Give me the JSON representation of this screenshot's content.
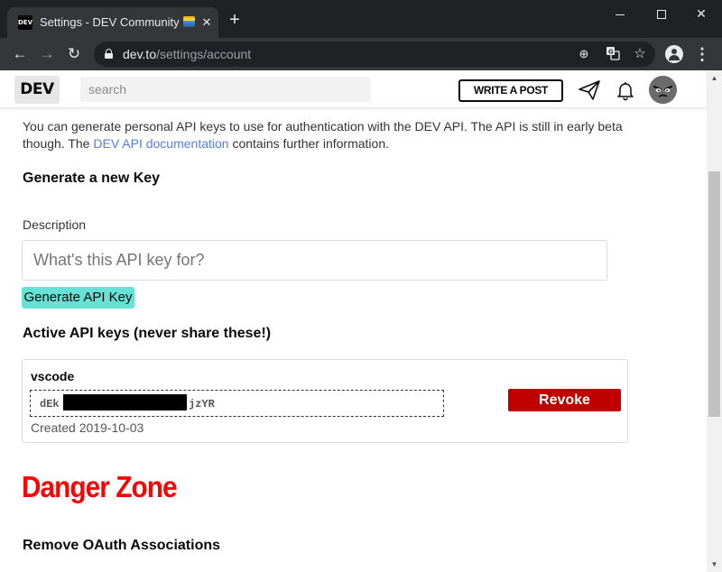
{
  "browser": {
    "tab": {
      "title": "Settings - DEV Community",
      "favicon_text": "DEV",
      "close_glyph": "✕"
    },
    "new_tab_glyph": "+",
    "address": {
      "host": "dev.to",
      "path": "/settings/account"
    },
    "window_controls": {
      "close_glyph": "✕"
    }
  },
  "site": {
    "logo": "DEV",
    "search": {
      "placeholder": "search"
    },
    "write_post": "WRITE A POST"
  },
  "content": {
    "intro_before": "You can generate personal API keys to use for authentication with the DEV API. The API is still in early beta though. The ",
    "intro_link": "DEV API documentation",
    "intro_after": " contains further information.",
    "generate_heading": "Generate a new Key",
    "description_label": "Description",
    "description_placeholder": "What's this API key for?",
    "generate_button": "Generate API Key",
    "active_heading": "Active API keys (never share these!)",
    "keys": [
      {
        "name": "vscode",
        "key_prefix": "dEk",
        "key_suffix": "jzYR",
        "created": "Created 2019-10-03",
        "revoke_label": "Revoke"
      }
    ],
    "danger_heading": "Danger Zone",
    "oauth_heading": "Remove OAuth Associations"
  },
  "colors": {
    "accent_teal": "#66e2d5",
    "revoke_red": "#c00000",
    "danger_red": "#ff0000",
    "link_blue": "#557de8"
  }
}
